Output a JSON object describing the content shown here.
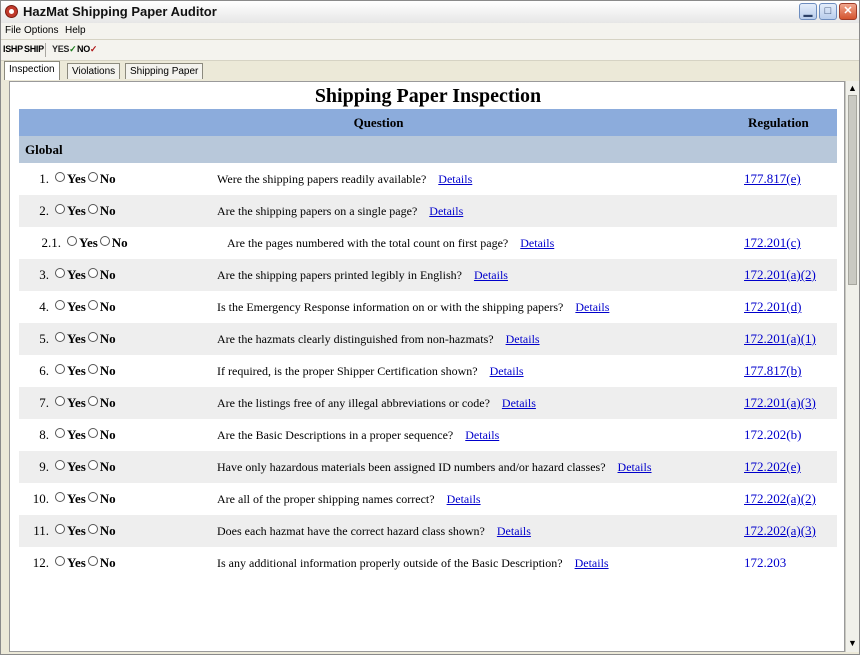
{
  "window": {
    "title": "HazMat Shipping Paper Auditor"
  },
  "menu": {
    "items": [
      "File",
      "Options",
      "Help"
    ]
  },
  "toolbar": {
    "buttons": [
      "ISHP",
      "SHIP",
      "YES",
      "NO"
    ]
  },
  "tabs": [
    {
      "label": "Inspection",
      "active": true
    },
    {
      "label": "Violations",
      "active": false
    },
    {
      "label": "Shipping Paper",
      "active": false
    }
  ],
  "page": {
    "heading": "Shipping Paper Inspection",
    "columns": {
      "question": "Question",
      "regulation": "Regulation"
    },
    "section": "Global",
    "yes_label": "Yes",
    "no_label": "No",
    "details_label": "Details",
    "rows": [
      {
        "num": "1.",
        "question": "Were the shipping papers readily available?",
        "regulation": "177.817(e)",
        "reg_linked": true,
        "sub": false
      },
      {
        "num": "2.",
        "question": "Are the shipping papers on a single page?",
        "regulation": "",
        "reg_linked": false,
        "sub": false
      },
      {
        "num": "2.1.",
        "question": "Are the pages numbered with the total count on first page?",
        "regulation": "172.201(c)",
        "reg_linked": true,
        "sub": true
      },
      {
        "num": "3.",
        "question": "Are the shipping papers printed legibly in English?",
        "regulation": "172.201(a)(2)",
        "reg_linked": true,
        "sub": false
      },
      {
        "num": "4.",
        "question": "Is the Emergency Response information on or with the shipping papers?",
        "regulation": "172.201(d)",
        "reg_linked": true,
        "sub": false
      },
      {
        "num": "5.",
        "question": "Are the hazmats clearly distinguished from non-hazmats?",
        "regulation": "172.201(a)(1)",
        "reg_linked": true,
        "sub": false
      },
      {
        "num": "6.",
        "question": "If required, is the proper Shipper Certification shown?",
        "regulation": "177.817(b)",
        "reg_linked": true,
        "sub": false
      },
      {
        "num": "7.",
        "question": "Are the listings free of any illegal abbreviations or code?",
        "regulation": "172.201(a)(3)",
        "reg_linked": true,
        "sub": false
      },
      {
        "num": "8.",
        "question": "Are the Basic Descriptions in a proper sequence?",
        "regulation": "172.202(b)",
        "reg_linked": false,
        "sub": false
      },
      {
        "num": "9.",
        "question": "Have only hazardous materials been assigned ID numbers and/or hazard classes?",
        "regulation": "172.202(e)",
        "reg_linked": true,
        "sub": false
      },
      {
        "num": "10.",
        "question": "Are all of the proper shipping names correct?",
        "regulation": "172.202(a)(2)",
        "reg_linked": true,
        "sub": false
      },
      {
        "num": "11.",
        "question": "Does each hazmat have the correct hazard class shown?",
        "regulation": "172.202(a)(3)",
        "reg_linked": true,
        "sub": false
      },
      {
        "num": "12.",
        "question": "Is any additional information properly outside of the Basic Description?",
        "regulation": "172.203",
        "reg_linked": false,
        "sub": false
      }
    ]
  }
}
